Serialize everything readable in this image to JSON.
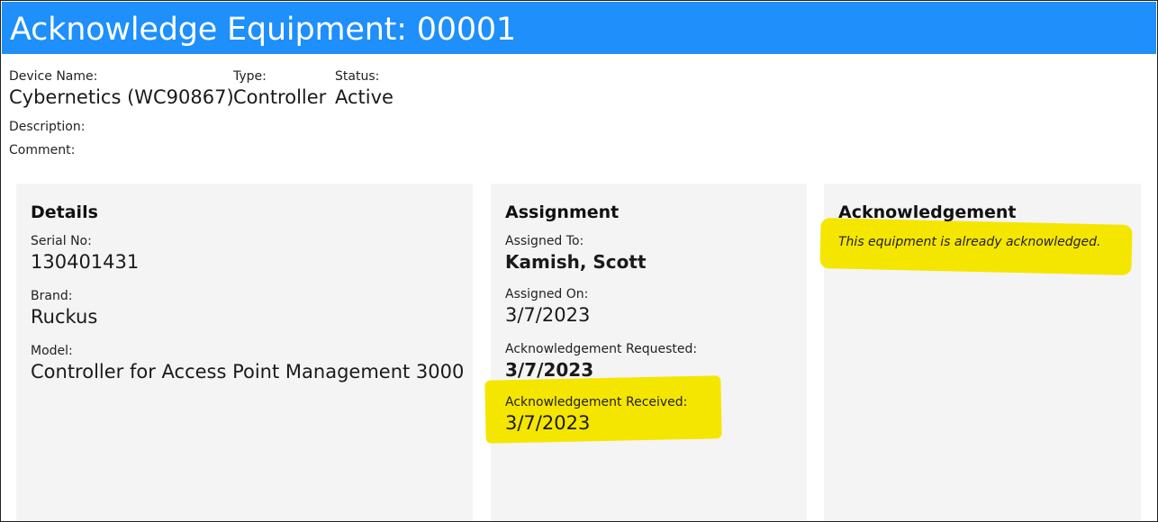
{
  "header": {
    "title": "Acknowledge Equipment: 00001",
    "accent_color": "#1e8ffb"
  },
  "device": {
    "name_label": "Device Name:",
    "name_value": "Cybernetics (WC90867)",
    "type_label": "Type:",
    "type_value": "Controller",
    "status_label": "Status:",
    "status_value": "Active",
    "description_label": "Description:",
    "comment_label": "Comment:"
  },
  "details": {
    "title": "Details",
    "serial_label": "Serial No:",
    "serial_value": "130401431",
    "brand_label": "Brand:",
    "brand_value": "Ruckus",
    "model_label": "Model:",
    "model_value": "Controller for Access Point Management 3000"
  },
  "assignment": {
    "title": "Assignment",
    "assigned_to_label": "Assigned To:",
    "assigned_to_value": "Kamish, Scott",
    "assigned_on_label": "Assigned On:",
    "assigned_on_value": "3/7/2023",
    "ack_requested_label": "Acknowledgement Requested:",
    "ack_requested_value": "3/7/2023",
    "ack_received_label": "Acknowledgement Received:",
    "ack_received_value": "3/7/2023"
  },
  "acknowledgement": {
    "title": "Acknowledgement",
    "message": "This equipment is already acknowledged.",
    "highlight_color": "#f5e600"
  }
}
